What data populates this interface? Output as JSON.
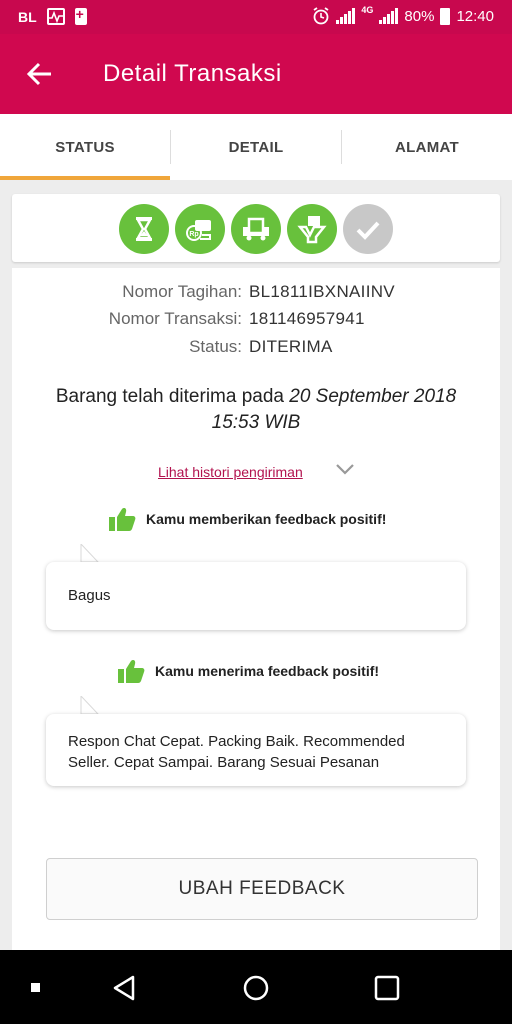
{
  "status_bar": {
    "carrier": "BL",
    "network_type": "4G",
    "battery": "80%",
    "time": "12:40"
  },
  "app_bar": {
    "title": "Detail Transaksi"
  },
  "tabs": [
    {
      "label": "STATUS",
      "active": true
    },
    {
      "label": "DETAIL",
      "active": false
    },
    {
      "label": "ALAMAT",
      "active": false
    }
  ],
  "steps": [
    {
      "icon": "hourglass-icon",
      "done": true
    },
    {
      "icon": "payment-icon",
      "done": true
    },
    {
      "icon": "truck-icon",
      "done": true
    },
    {
      "icon": "package-received-icon",
      "done": true
    },
    {
      "icon": "checkmark-icon",
      "done": false
    }
  ],
  "transaction": {
    "invoice_label": "Nomor Tagihan:",
    "invoice_value": "BL1811IBXNAIINV",
    "transaction_label": "Nomor Transaksi:",
    "transaction_value": "181146957941",
    "status_label": "Status:",
    "status_value": "DITERIMA"
  },
  "received": {
    "prefix": "Barang telah diterima pada",
    "date": "20 September 2018",
    "time": "15:53 WIB"
  },
  "history_link": "Lihat histori pengiriman",
  "feedback_given": {
    "heading": "Kamu memberikan feedback positif!",
    "message": "Bagus"
  },
  "feedback_received": {
    "heading": "Kamu menerima feedback positif!",
    "message": "Respon Chat Cepat. Packing Baik. Recommended Seller. Cepat Sampai. Barang Sesuai Pesanan"
  },
  "ubah_button": "UBAH FEEDBACK",
  "colors": {
    "brand": "#d0084f",
    "tab_indicator": "#f0a63a",
    "step_done": "#68c13c",
    "step_pending": "#c8c8c8",
    "link": "#b2124e"
  }
}
